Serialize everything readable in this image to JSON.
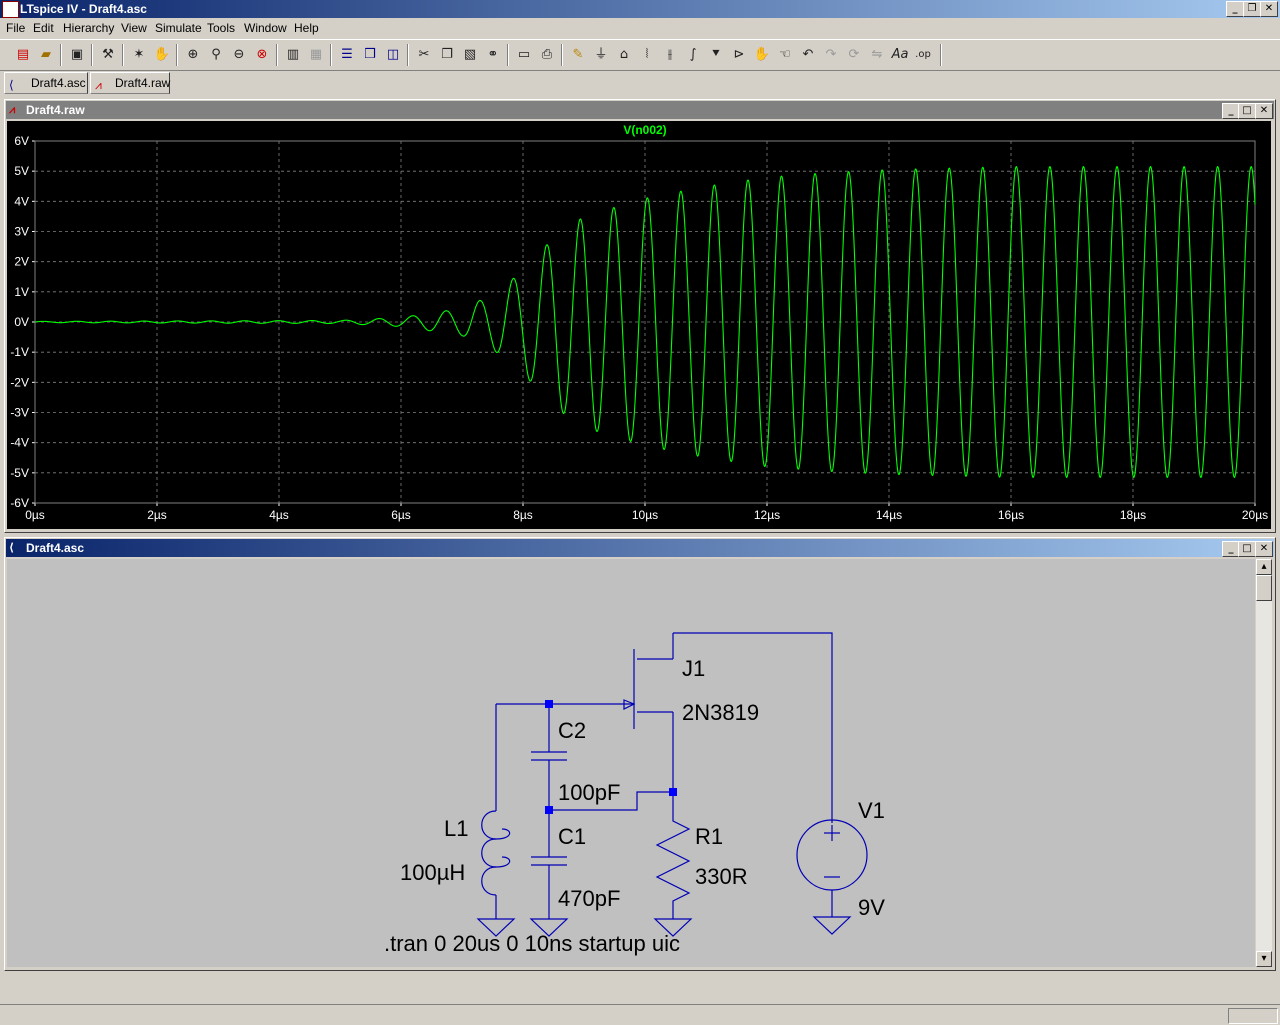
{
  "app": {
    "title": "LTspice IV - Draft4.asc"
  },
  "menu": [
    "File",
    "Edit",
    "Hierarchy",
    "View",
    "Simulate",
    "Tools",
    "Window",
    "Help"
  ],
  "toolbar_icons": [
    "new-schematic-icon",
    "open-icon",
    "save-icon",
    "control-panel-icon",
    "run-icon",
    "halt-icon",
    "zoom-in-icon",
    "zoom-area-icon",
    "zoom-out-icon",
    "zoom-fit-icon",
    "autorange-icon",
    "grid-icon",
    "tile-horizontal-icon",
    "cascade-icon",
    "tile-vertical-icon",
    "cut-icon",
    "copy-icon",
    "paste-icon",
    "find-icon",
    "print-setup-icon",
    "print-icon",
    "draw-wire-icon",
    "ground-icon",
    "label-net-icon",
    "resistor-icon",
    "capacitor-icon",
    "inductor-icon",
    "diode-icon",
    "component-icon",
    "move-icon",
    "drag-icon",
    "undo-icon",
    "redo-icon",
    "rotate-icon",
    "mirror-icon",
    "text-icon",
    "spice-directive-icon"
  ],
  "tabs": [
    {
      "label": "Draft4.asc",
      "icon": "schematic-icon"
    },
    {
      "label": "Draft4.raw",
      "icon": "waveform-icon"
    }
  ],
  "plot_window": {
    "title": "Draft4.raw"
  },
  "schematic_window": {
    "title": "Draft4.asc"
  },
  "chart_data": {
    "type": "line",
    "title": "V(n002)",
    "series": [
      {
        "name": "V(n002)",
        "color": "#00ff00",
        "envelope": {
          "x": [
            0,
            5,
            6,
            7,
            7.5,
            8,
            8.5,
            9,
            10,
            11,
            12,
            13,
            14,
            15,
            16,
            17,
            18,
            19,
            20
          ],
          "amplitude": [
            0.02,
            0.05,
            0.15,
            0.45,
            0.9,
            1.7,
            2.8,
            3.5,
            4.1,
            4.5,
            4.8,
            4.95,
            5.05,
            5.1,
            5.15,
            5.15,
            5.15,
            5.15,
            5.15
          ]
        },
        "period_us": 0.55
      }
    ],
    "xlim": [
      0,
      20
    ],
    "ylim": [
      -6,
      6
    ],
    "xticks": [
      "0µs",
      "2µs",
      "4µs",
      "6µs",
      "8µs",
      "10µs",
      "12µs",
      "14µs",
      "16µs",
      "18µs",
      "20µs"
    ],
    "yticks": [
      "6V",
      "5V",
      "4V",
      "3V",
      "2V",
      "1V",
      "0V",
      "-1V",
      "-2V",
      "-3V",
      "-4V",
      "-5V",
      "-6V"
    ],
    "grid": true,
    "colors": {
      "background": "#000000",
      "trace": "#00ff00",
      "grid": "#808080",
      "axis_text": "#ffffff"
    }
  },
  "schematic": {
    "colors": {
      "wire": "#0000b4",
      "background": "#c0c0c0",
      "junction": "#0000ff",
      "text": "#000000"
    },
    "components": [
      {
        "ref": "J1",
        "value": "2N3819"
      },
      {
        "ref": "C2",
        "value": "100pF"
      },
      {
        "ref": "C1",
        "value": "470pF"
      },
      {
        "ref": "L1",
        "value": "100µH"
      },
      {
        "ref": "R1",
        "value": "330R"
      },
      {
        "ref": "V1",
        "value": "9V"
      }
    ],
    "directive": ".tran 0 20us 0 10ns startup uic"
  }
}
